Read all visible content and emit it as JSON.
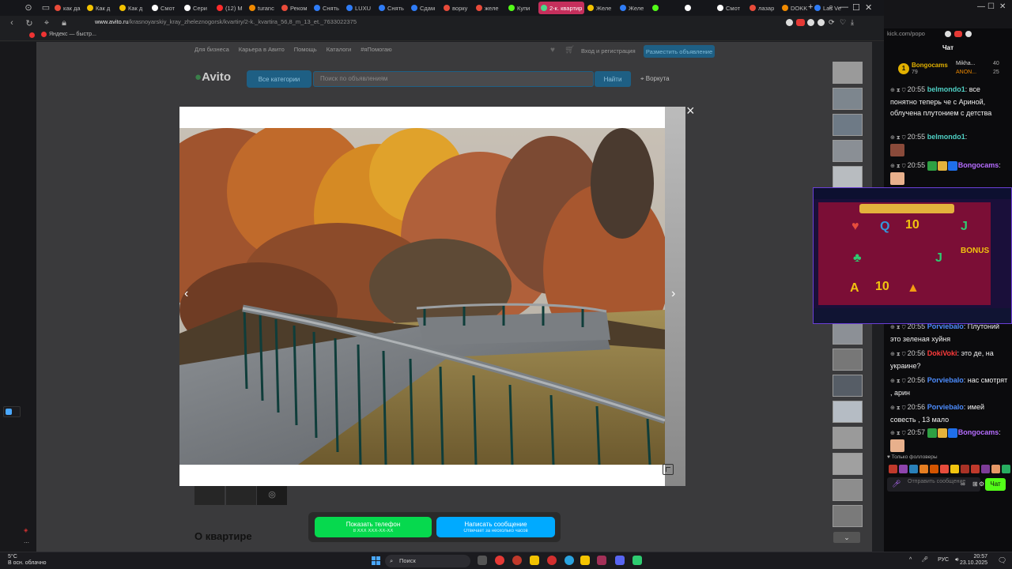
{
  "browser": {
    "tabs": [
      {
        "label": "как да",
        "color": "#e84b3a"
      },
      {
        "label": "Как д",
        "color": "#f2c200"
      },
      {
        "label": "Как д",
        "color": "#f2c200"
      },
      {
        "label": "Смот",
        "color": "#ffffff"
      },
      {
        "label": "Сери",
        "color": "#ffffff"
      },
      {
        "label": "(12) M",
        "color": "#ff2b2b"
      },
      {
        "label": "turanc",
        "color": "#f08a00"
      },
      {
        "label": "Реком",
        "color": "#e84b3a"
      },
      {
        "label": "Снять",
        "color": "#2f7cf6"
      },
      {
        "label": "LUXU",
        "color": "#2f7cf6"
      },
      {
        "label": "Снять",
        "color": "#2f7cf6"
      },
      {
        "label": "Сдам",
        "color": "#2f7cf6"
      },
      {
        "label": "ворку",
        "color": "#e84b3a"
      },
      {
        "label": "желе",
        "color": "#e84b3a"
      },
      {
        "label": "Купи",
        "color": "#53fc18"
      },
      {
        "label": "2-к. квартир",
        "color": "#4ad98a",
        "active": true
      },
      {
        "label": "Желе",
        "color": "#f2c200"
      },
      {
        "label": "Желе",
        "color": "#2f7cf6"
      },
      {
        "label": "",
        "color": "#53fc18"
      },
      {
        "label": "",
        "color": "#ffffff"
      },
      {
        "label": "Смот",
        "color": "#ffffff"
      },
      {
        "label": "лазар",
        "color": "#e84b3a"
      },
      {
        "label": "DOKK",
        "color": "#f08a00"
      },
      {
        "label": "Las Ve",
        "color": "#2f7cf6"
      }
    ],
    "url_host": "www.avito.ru",
    "url_path": "/krasnoyarskiy_kray_zheleznogorsk/kvartiry/2-k._kvartira_56,8_m_13_et._7633022375",
    "bookmark": "Яндекс — быстр..."
  },
  "avito": {
    "nav": [
      "Для бизнеса",
      "Карьера в Авито",
      "Помощь",
      "Каталоги",
      "#яПомогаю"
    ],
    "login": "Вход и регистрация",
    "post_ad": "Разместить объявление",
    "logo": "Avito",
    "categories": "Все категории",
    "search_placeholder": "Поиск по объявлениям",
    "find": "Найти",
    "city": "Воркута",
    "about": "О квартире"
  },
  "modal": {
    "close": "×",
    "prev": "‹",
    "next": "›"
  },
  "cta": {
    "phone_label": "Показать телефон",
    "phone_sub": "8 XXX XXX-XX-XX",
    "msg_label": "Написать сообщение",
    "msg_sub": "Отвечает за несколько часов"
  },
  "chat": {
    "url": "kick.com/popo",
    "title": "Чат",
    "leaders": [
      {
        "name": "Bongocams",
        "score": "79"
      },
      {
        "name": "Mikha...",
        "score": "40"
      },
      {
        "name": "ANON...",
        "score": "25"
      }
    ],
    "messages": [
      {
        "time": "20:55",
        "user": "belmondo1",
        "color": "#4fd1c5",
        "text": "все понятно теперь че с Ариной, облучена плутонием с детства"
      },
      {
        "time": "20:55",
        "user": "belmondo1",
        "color": "#4fd1c5",
        "text": ""
      },
      {
        "time": "20:55",
        "user": "Bongocams",
        "color": "#b66dff",
        "text": ""
      },
      {
        "time": "20:55",
        "user": "Porviebalo",
        "color": "#4d8dff",
        "text": "Плутоний это зеленая хуйня"
      },
      {
        "time": "20:56",
        "user": "DokiVoki",
        "color": "#ff3b3b",
        "text": "это де, на украине?"
      },
      {
        "time": "20:56",
        "user": "Porviebalo",
        "color": "#4d8dff",
        "text": "нас смотрят , арин"
      },
      {
        "time": "20:56",
        "user": "Porviebalo",
        "color": "#4d8dff",
        "text": "имей совесть , 13 мало"
      },
      {
        "time": "20:57",
        "user": "Bongocams",
        "color": "#b66dff",
        "text": ""
      }
    ],
    "followers_only": "Только фолловеры",
    "input_placeholder": "Отправить сообщение",
    "send": "Чат"
  },
  "taskbar": {
    "temp": "5°C",
    "weather": "В осн. облачно",
    "search": "Поиск",
    "lang": "РУС",
    "time": "20:57",
    "date": "23.10.2025"
  }
}
